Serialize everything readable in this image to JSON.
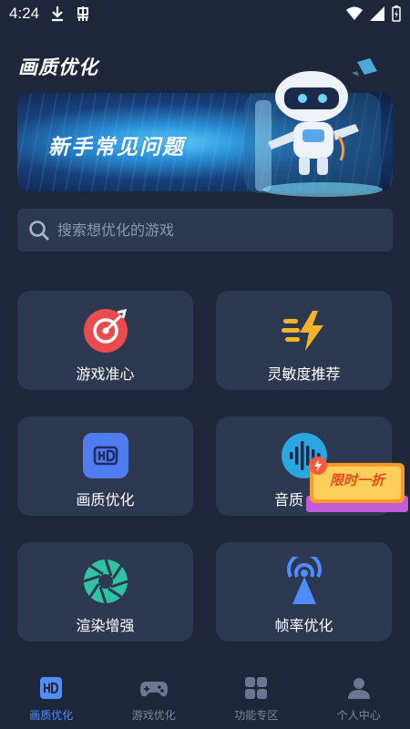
{
  "status_bar": {
    "time": "4:24"
  },
  "header": {
    "title": "画质优化"
  },
  "banner": {
    "text": "新手常见问题"
  },
  "search": {
    "placeholder": "搜索想优化的游戏"
  },
  "cards": [
    {
      "label": "游戏准心",
      "icon": "crosshair-target-icon"
    },
    {
      "label": "灵敏度推荐",
      "icon": "lightning-bolt-icon"
    },
    {
      "label": "画质优化",
      "icon": "hd-icon"
    },
    {
      "label": "音质",
      "icon": "sound-wave-icon"
    },
    {
      "label": "渲染增强",
      "icon": "aperture-icon"
    },
    {
      "label": "帧率优化",
      "icon": "signal-tower-icon"
    }
  ],
  "promo": {
    "text": "限时一折"
  },
  "bottom_nav": [
    {
      "label": "画质优化",
      "icon": "hd-icon",
      "active": true
    },
    {
      "label": "游戏优化",
      "icon": "gamepad-icon",
      "active": false
    },
    {
      "label": "功能专区",
      "icon": "grid-icon",
      "active": false
    },
    {
      "label": "个人中心",
      "icon": "person-icon",
      "active": false
    }
  ],
  "colors": {
    "background": "#1e2639",
    "card": "#2c3750",
    "accent": "#4f8cff",
    "nav_inactive": "#7d879c"
  }
}
